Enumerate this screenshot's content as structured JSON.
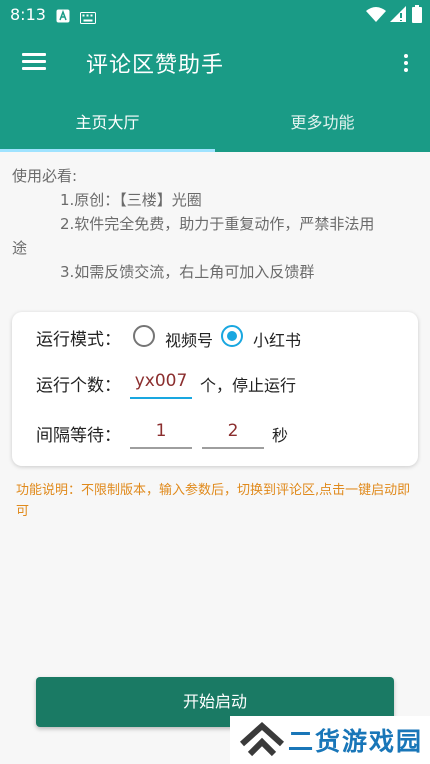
{
  "status_bar": {
    "time": "8:13",
    "icons": [
      "a-box-icon",
      "keyboard-icon",
      "wifi-icon",
      "signal-icon",
      "battery-icon"
    ]
  },
  "app_bar": {
    "title": "评论区赞助手",
    "menu_icon": "hamburger-menu-icon",
    "more_icon": "more-vert-icon"
  },
  "tabs": [
    {
      "label": "主页大厅",
      "selected": true
    },
    {
      "label": "更多功能",
      "selected": false
    }
  ],
  "intro": {
    "heading": "使用必看:",
    "line1": "1.原创：【三楼】光圈",
    "line2a": "2.软件完全免费，助力于重复动作，严禁非法用",
    "line2b": "途",
    "line3": "3.如需反馈交流，右上角可加入反馈群"
  },
  "settings": {
    "mode_label": "运行模式：",
    "mode_options": [
      {
        "label": "视频号",
        "selected": false
      },
      {
        "label": "小红书",
        "selected": true
      }
    ],
    "count_label": "运行个数：",
    "count_value": "yx007",
    "count_suffix": "个，停止运行",
    "interval_label": "间隔等待：",
    "interval_min": "1",
    "interval_max": "2",
    "interval_unit": "秒"
  },
  "note": "功能说明：不限制版本，输入参数后，切换到评论区,点击一键启动即可",
  "start_button": "开始启动",
  "watermark": {
    "text": "二货游戏园"
  },
  "colors": {
    "primary": "#1a9b86",
    "button": "#1a7a64",
    "accent": "#19a7e0",
    "note": "#e08a1c",
    "watermark": "#1976b8"
  }
}
